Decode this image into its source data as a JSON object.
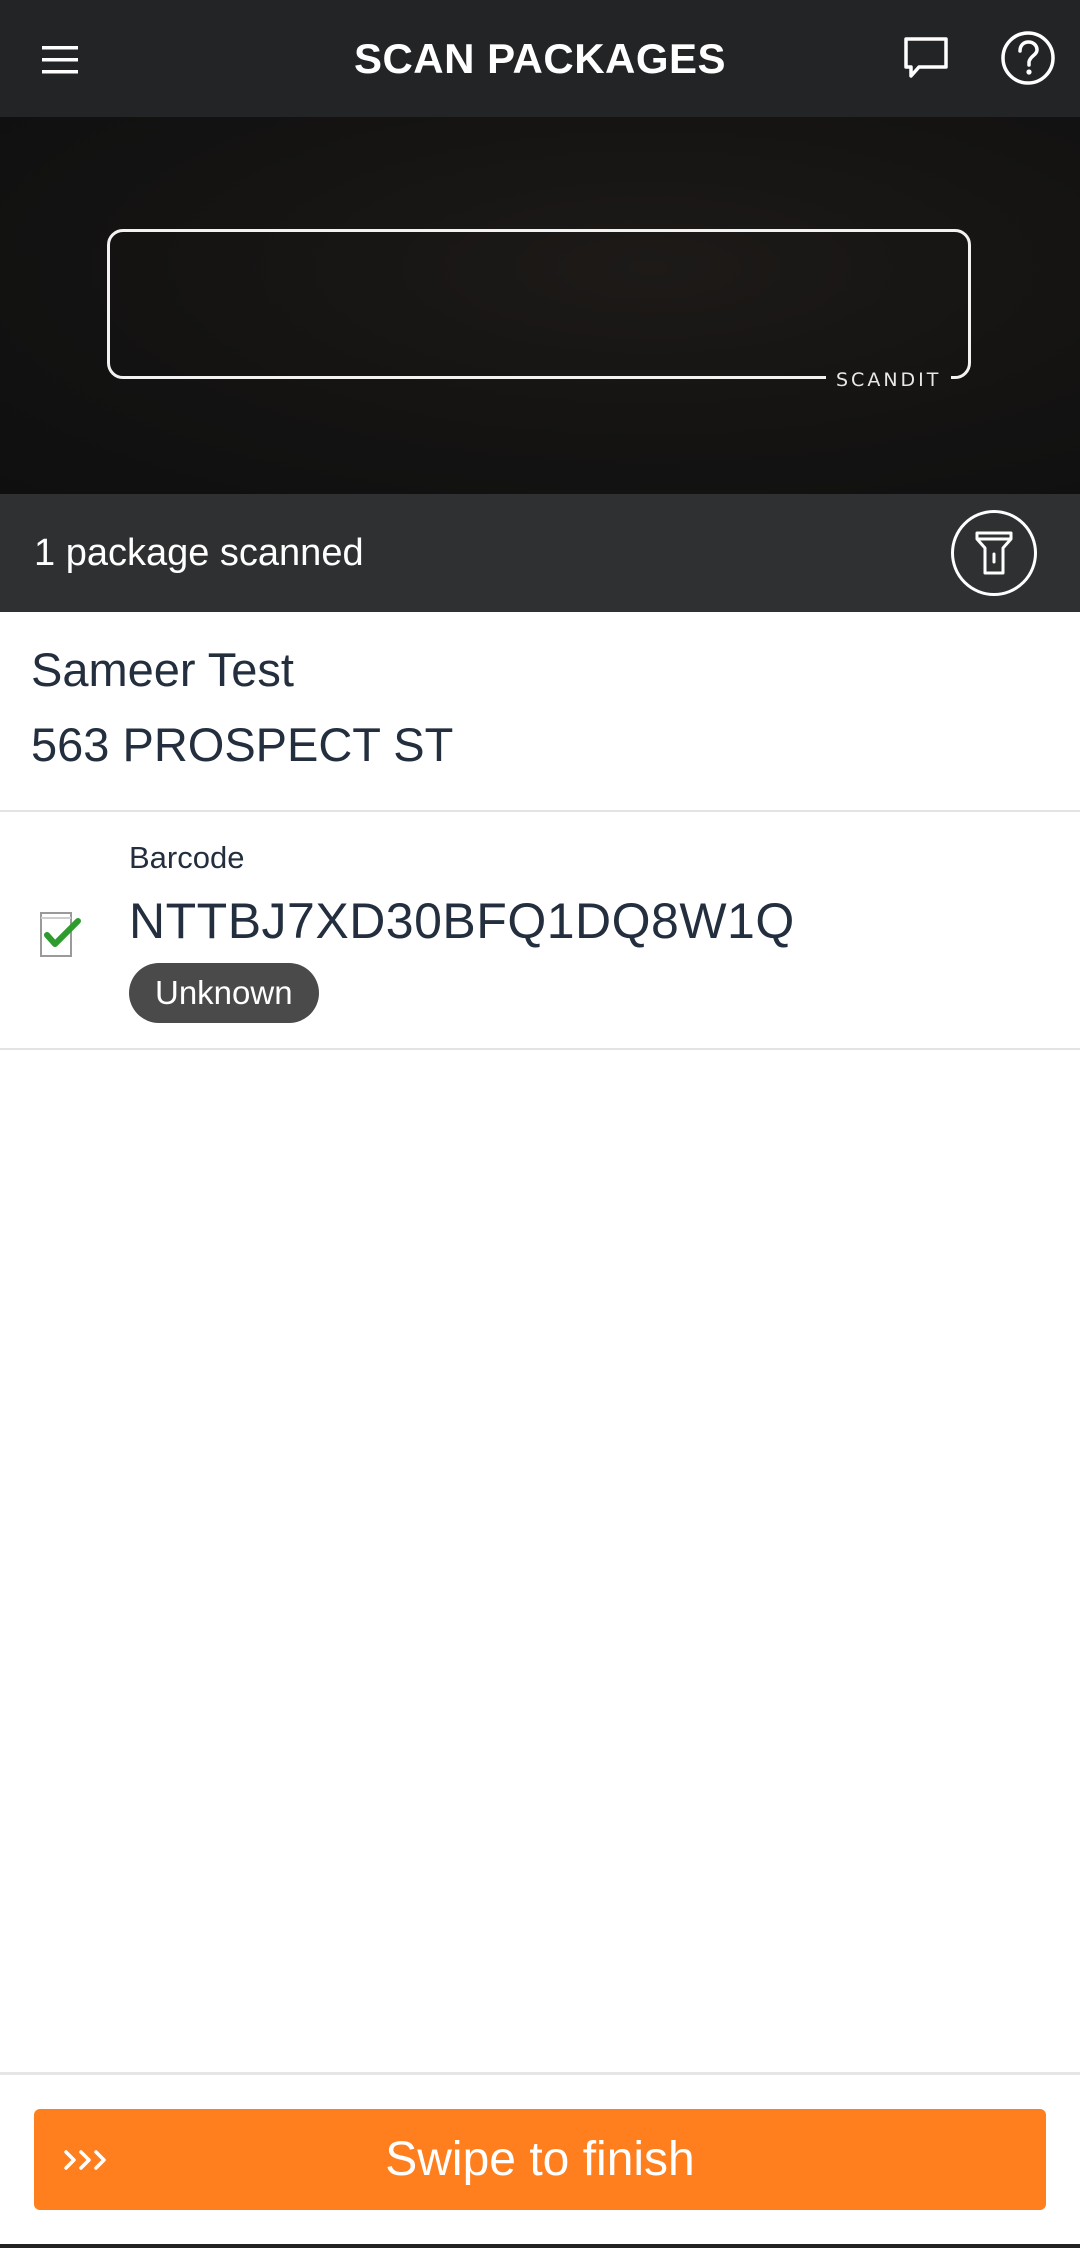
{
  "header": {
    "title": "SCAN PACKAGES",
    "menu_icon": "hamburger-menu-icon",
    "chat_icon": "chat-bubble-icon",
    "help_icon": "help-circle-icon"
  },
  "scanner": {
    "brand": "SCANDIT"
  },
  "status": {
    "count_text": "1 package scanned",
    "torch_icon": "flashlight-icon"
  },
  "address": {
    "name": "Sameer Test",
    "street": "563 PROSPECT ST"
  },
  "packages": [
    {
      "label": "Barcode",
      "barcode": "NTTBJ7XD30BFQ1DQ8W1Q",
      "status": "Unknown",
      "checked": true
    }
  ],
  "footer": {
    "swipe_label": "Swipe to finish",
    "swipe_icon": "triple-chevron-right-icon"
  },
  "colors": {
    "header_bg": "#232425",
    "status_bg": "#2f3031",
    "accent": "#ff7f1e",
    "check": "#2e9b2e",
    "badge_bg": "#4a4a4a"
  }
}
